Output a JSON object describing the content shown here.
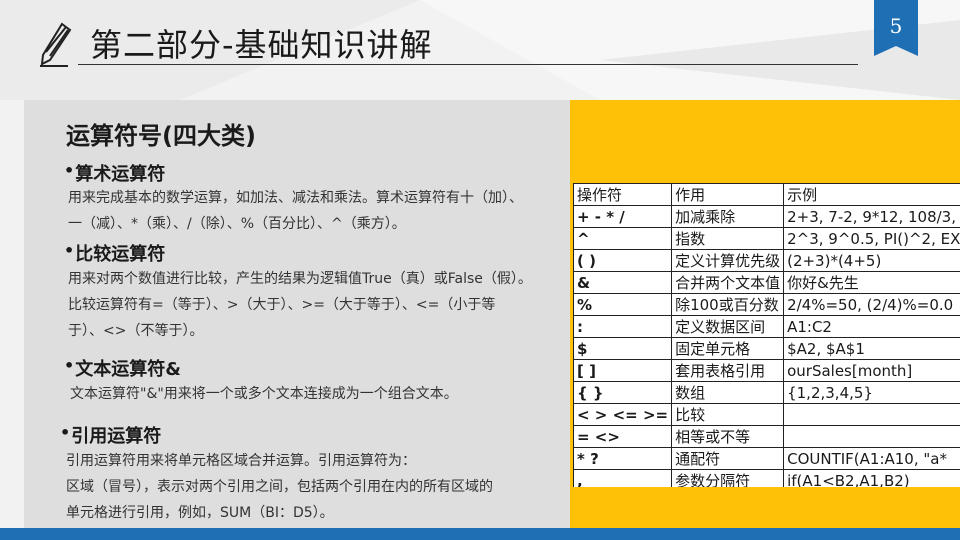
{
  "header": {
    "title": "第二部分-基础知识讲解",
    "page_number": "5"
  },
  "main": {
    "heading": "运算符号(四大类)",
    "sections": [
      {
        "title": "算术运算符",
        "lines": [
          "用来完成基本的数学运算，如加法、减法和乘法。算术运算符有十（加）、",
          "一（减）、*（乘）、/（除）、%（百分比）、^（乘方）。"
        ]
      },
      {
        "title": "比较运算符",
        "lines": [
          "用来对两个数值进行比较，产生的结果为逻辑值True（真）或False（假）。",
          "比较运算符有=（等于）、>（大于）、>=（大于等于）、<=（小于等",
          "于）、<>（不等于）。"
        ]
      },
      {
        "title": "文本运算符&",
        "lines": [
          "文本运算符\"&\"用来将一个或多个文本连接成为一个组合文本。"
        ]
      },
      {
        "title": "引用运算符",
        "lines": [
          "引用运算符用来将单元格区域合并运算。引用运算符为：",
          "区域（冒号），表示对两个引用之间，包括两个引用在内的所有区域的",
          "单元格进行引用，例如，SUM（BI：D5）。"
        ]
      }
    ]
  },
  "table": {
    "headers": [
      "操作符",
      "作用",
      "示例"
    ],
    "rows": [
      [
        "+ - * /",
        "加减乘除",
        "2+3, 7-2, 9*12, 108/3,"
      ],
      [
        "^",
        "指数",
        "2^3, 9^0.5, PI()^2, EX"
      ],
      [
        "( )",
        "定义计算优先级",
        "(2+3)*(4+5)"
      ],
      [
        "&",
        "合并两个文本值",
        "你好&先生"
      ],
      [
        "%",
        "除100或百分数",
        "2/4%=50, (2/4)%=0.0"
      ],
      [
        ":",
        "定义数据区间",
        "A1:C2"
      ],
      [
        "$",
        "固定单元格",
        "$A2, $A$1"
      ],
      [
        "[ ]",
        "套用表格引用",
        "ourSales[month]"
      ],
      [
        "{ }",
        "数组",
        "{1,2,3,4,5}"
      ],
      [
        "< > <= >=",
        "比较",
        ""
      ],
      [
        "= <>",
        "相等或不等",
        ""
      ],
      [
        "* ?",
        "通配符",
        "COUNTIF(A1:A10,   \"a*"
      ],
      [
        ",",
        "参数分隔符",
        "if(A1<B2,A1,B2)"
      ]
    ]
  },
  "colors": {
    "accent_blue": "#1f6fb5",
    "accent_yellow": "#ffc107"
  },
  "icons": {
    "header_icon": "pencil-icon"
  }
}
